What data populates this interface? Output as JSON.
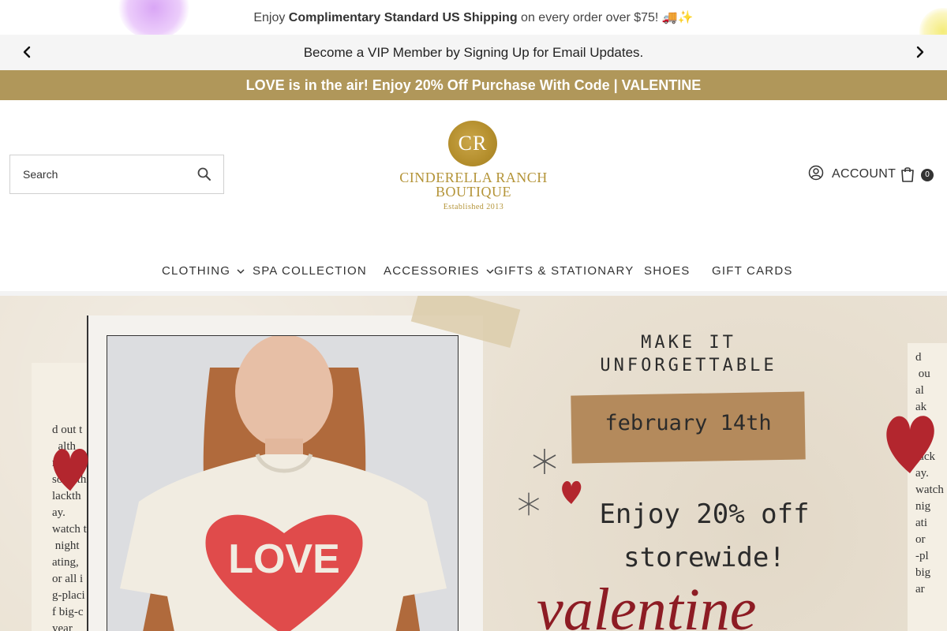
{
  "shipping_bar": {
    "prefix": "Enjoy ",
    "highlight": "Complimentary Standard US Shipping",
    "suffix": " on every order over $75! 🚚✨"
  },
  "vip_bar": {
    "text": "Become a VIP Member by Signing Up for Email Updates.",
    "prev_icon": "chevron-left-icon",
    "next_icon": "chevron-right-icon"
  },
  "promo_bar": {
    "text": "LOVE is in the air! Enjoy 20% Off Purchase With Code | VALENTINE",
    "color": "#b0975a"
  },
  "header": {
    "search": {
      "placeholder": "Search",
      "icon": "search-icon"
    },
    "logo": {
      "monogram": "CR",
      "line1": "CINDERELLA RANCH",
      "line2": "BOUTIQUE",
      "established": "Established 2013",
      "color": "#b49438"
    },
    "account": {
      "label": "ACCOUNT",
      "icon": "user-circle-icon"
    },
    "cart": {
      "count": "0",
      "icon": "shopping-bag-icon"
    }
  },
  "nav": {
    "items": [
      {
        "label": "CLOTHING",
        "has_dropdown": true
      },
      {
        "label": "SPA COLLECTION",
        "has_dropdown": false
      },
      {
        "label": "ACCESSORIES",
        "has_dropdown": true
      },
      {
        "label": "GIFTS & STATIONARY",
        "has_dropdown": false
      },
      {
        "label": "SHOES",
        "has_dropdown": false
      },
      {
        "label": "GIFT CARDS",
        "has_dropdown": false
      }
    ]
  },
  "hero": {
    "headline_line1": "MAKE IT",
    "headline_line2": "UNFORGETTABLE",
    "date": "february 14th",
    "offer_line1": "Enjoy 20% off",
    "offer_line2": "storewide!",
    "script_text": "valentine",
    "news_left": "d out t\n  alth\nme o\nsomethi\nlackth\nay.\nwatch tic\n night\nating,\nor all i\ng-placi\nf big-c\nyear",
    "news_right": "d\n ou\nal\nak\nlay\n.m\nlack\nay.\nwatch\nnig\nati\nor\n-pl\nbig\nar",
    "tshirt_text": "LOVE",
    "heart_color": "#b3262e"
  }
}
